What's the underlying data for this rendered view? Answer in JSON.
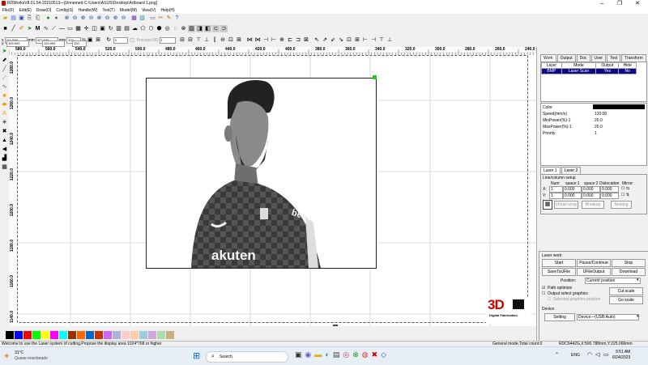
{
  "window": {
    "title": "RDWorksV8.01.54-20210513—[Unnamed-C:\\Users\\ASUS\\Desktop\\Artboard 1.png]",
    "minimize": "–",
    "maximize": "❐",
    "close": "✕"
  },
  "menu": [
    "File(F)",
    "Edit(E)",
    "Draw(D)",
    "Config(S)",
    "Handle(W)",
    "Text(T)",
    "Model(M)",
    "View(V)",
    "Help(H)"
  ],
  "toolbar_pos": {
    "x_label": "x",
    "x_value": "411.098",
    "y_label": "y",
    "y_value": "109.993",
    "mm": "mm",
    "w_value": "427.609",
    "h_value": "120.993",
    "pct1": "100",
    "pct2": "100",
    "pct": "%",
    "angle": "0",
    "process_no_label": "Process NO",
    "process_no": "1"
  },
  "rulers": {
    "top": [
      "580.0",
      "560.0",
      "540.0",
      "520.0",
      "500.0",
      "480.0",
      "460.0",
      "440.0",
      "420.0",
      "400.0",
      "380.0",
      "360.0",
      "340.0",
      "320.0",
      "300.0",
      "280.0",
      "260.0",
      "240.0"
    ],
    "left": [
      "1280.0",
      "1260.0",
      "1240.0",
      "1220.0",
      "1200.0",
      "1180.0",
      "1160.0",
      "1140.0"
    ]
  },
  "panel": {
    "tabs": [
      "Work",
      "Output",
      "Doc",
      "User",
      "Test",
      "Transform"
    ],
    "layer_headers": [
      "Layer",
      "Mode",
      "Output",
      "Hide"
    ],
    "layer_row": {
      "layer": "BMP",
      "mode": "Laser Scan",
      "output": "Yes",
      "hide": "No"
    },
    "props": [
      {
        "label": "Color",
        "value": ""
      },
      {
        "label": "Speed(mm/s)",
        "value": "120.00"
      },
      {
        "label": "MinPower(%)-1",
        "value": "20.0"
      },
      {
        "label": "MaxPower(%)-1",
        "value": "20.0"
      },
      {
        "label": "Priority",
        "value": "1"
      }
    ],
    "laser_tabs": [
      "Laser 1",
      "Laser 2"
    ],
    "array": {
      "title": "Line/column setup",
      "headers": [
        "Num",
        "space:1",
        "space:2",
        "Dislocation",
        "Mirror"
      ],
      "rows": [
        {
          "axis": "X:",
          "num": "1",
          "s1": "0.000",
          "s2": "0.000",
          "dis": "0.000"
        },
        {
          "axis": "Y:",
          "num": "1",
          "s1": "0.000",
          "s2": "0.000",
          "dis": "0.000"
        }
      ],
      "buttons": [
        "Virtual array",
        "Breakup",
        "Nesting"
      ]
    },
    "laser_work": {
      "title": "Laser work",
      "start": "Start",
      "pause": "Pause/Continue",
      "stop": "Stop",
      "save": "SaveToUFile",
      "ufile_output": "UFileOutput",
      "download": "Download",
      "position_label": "Position:",
      "position_value": "Current position",
      "path_optimize": "Path optimize",
      "output_select": "Output select graphics",
      "selected_pos": "Selected graphics position",
      "cut_scale": "Cut scale",
      "go_scale": "Go scale"
    },
    "device": {
      "title": "Device",
      "setting": "Setting",
      "value": "Device---(USB:Auto)"
    },
    "logo": {
      "big": "3D",
      "small": "Digital Fabrication"
    }
  },
  "palette": [
    "#000000",
    "#0000ff",
    "#ff0000",
    "#00ff00",
    "#ffff00",
    "#ff00ff",
    "#00ffff",
    "#993300",
    "#ff6600",
    "#0066cc",
    "#cc3300",
    "#cc66ff",
    "#b0b0e0",
    "#ffcccc",
    "#ffccaa",
    "#99ccdd",
    "#ccaadd",
    "#aaddaa",
    "#c8b080"
  ],
  "status": {
    "message": "Welcome to use the Laser system of cutting,Propose the display area 1024*768 or higher",
    "mode": "General mode,Total count:0",
    "coords": "RDC6442G,X:500.788mm,Y:225.066mm"
  },
  "taskbar": {
    "temp": "31°C",
    "weather": "Quase ensolarado",
    "search": "Search",
    "time": "9:51 AM",
    "date": "6/24/2023",
    "lang": "ENG"
  }
}
